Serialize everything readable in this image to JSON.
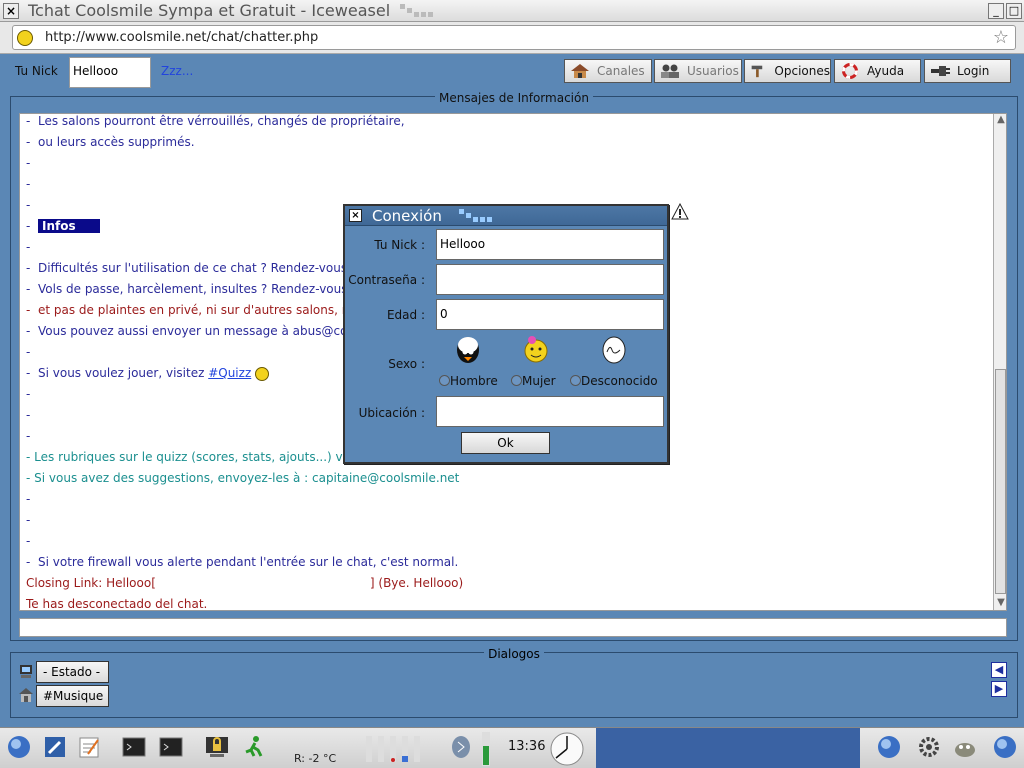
{
  "window": {
    "title": "Tchat Coolsmile Sympa et Gratuit - Iceweasel",
    "close_glyph": "×",
    "min_glyph": "_",
    "max_glyph": "□"
  },
  "browser": {
    "url": "http://www.coolsmile.net/chat/chatter.php",
    "bookmark_glyph": "☆"
  },
  "toolbar": {
    "nick_label": "Tu Nick",
    "nick_value": "Hellooo",
    "away_label": "Zzz...",
    "buttons": {
      "canales": "Canales",
      "usuarios": "Usuarios",
      "opciones": "Opciones",
      "ayuda": "Ayuda",
      "login": "Login"
    }
  },
  "messages_panel": {
    "title": "Mensajes de Información",
    "dash": "-",
    "lines": [
      "Les salons pourront être vérrouillés, changés de propriétaire,",
      "ou leurs accès supprimés.",
      "Infos",
      "Difficultés sur l'utilisation de ce chat ? Rendez-vous s",
      "Vols de passe, harcèlement, insultes ? Rendez-vous",
      "et pas de plaintes en privé, ni sur d'autres salons, m",
      "Vous pouvez aussi envoyer un message à abus@coo",
      "Si vous voulez jouer, visitez ",
      "#Quizz",
      "- Les rubriques sur le quizz (scores, stats, ajouts...) vo",
      "- Si vous avez des suggestions, envoyez-les à : capitaine@coolsmile.net",
      "Si votre firewall vous alerte pendant l'entrée sur le chat, c'est normal.",
      "Closing Link: Hellooo[",
      "] (Bye. Hellooo)",
      "Te has desconectado del chat."
    ]
  },
  "dialogs_panel": {
    "title": "Dialogos",
    "tabs": {
      "estado": "- Estado -",
      "musique": "#Musique"
    },
    "prev_glyph": "◀",
    "next_glyph": "▶"
  },
  "modal": {
    "title": "Conexión",
    "close_glyph": "×",
    "fields": {
      "nick_label": "Tu Nick :",
      "nick_value": "Hellooo",
      "password_label": "Contraseña :",
      "password_value": "",
      "age_label": "Edad :",
      "age_value": "0",
      "sex_label": "Sexo :",
      "location_label": "Ubicación :",
      "location_value": ""
    },
    "sex_options": {
      "male": "Hombre",
      "female": "Mujer",
      "unknown": "Desconocido"
    },
    "ok_label": "Ok"
  },
  "taskbar": {
    "weather": "R: -2 °C",
    "time": "13:36"
  },
  "colors": {
    "background": "#5b87b5",
    "info_highlight": "#0a0a8a",
    "message_blue": "#2b2b9a",
    "message_teal": "#1b8f8f",
    "message_red": "#9b1a1a"
  }
}
